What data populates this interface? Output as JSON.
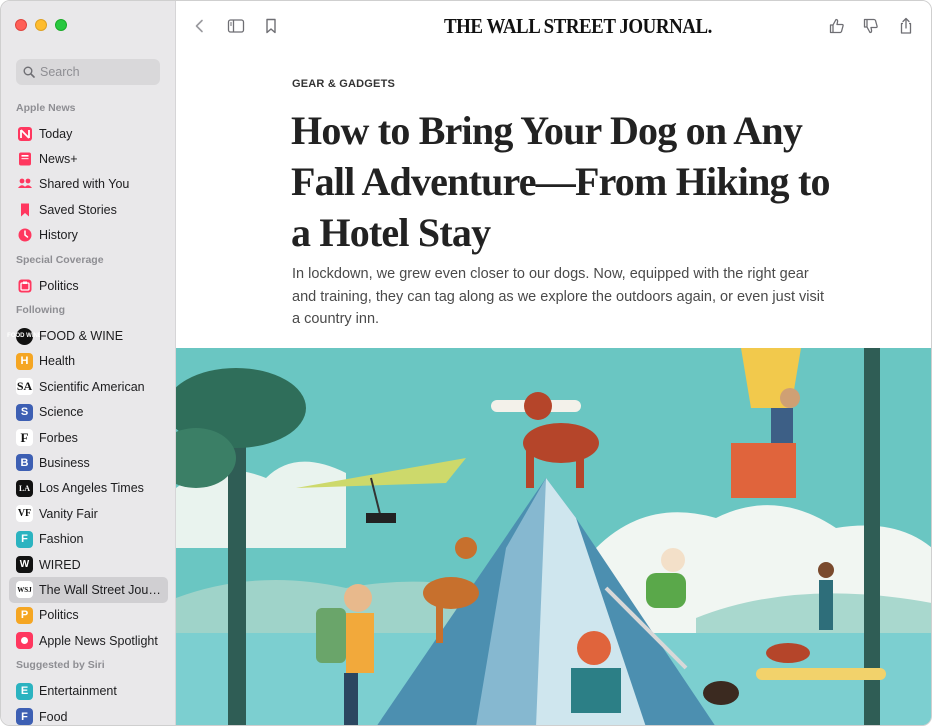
{
  "sidebar": {
    "search_placeholder": "Search",
    "sections": {
      "apple_news": "Apple News",
      "special_coverage": "Special Coverage",
      "following": "Following",
      "suggested": "Suggested by Siri"
    },
    "apple_news_items": [
      {
        "label": "Today",
        "icon": "news-logo-icon"
      },
      {
        "label": "News+",
        "icon": "news-plus-icon"
      },
      {
        "label": "Shared with You",
        "icon": "shared-people-icon"
      },
      {
        "label": "Saved Stories",
        "icon": "bookmark-icon"
      },
      {
        "label": "History",
        "icon": "clock-icon"
      }
    ],
    "special_items": [
      {
        "label": "Politics",
        "icon": "ballot-icon"
      }
    ],
    "following_items": [
      {
        "label": "FOOD & WINE",
        "badge": "FOOD WINE",
        "color": "#111111"
      },
      {
        "label": "Health",
        "badge": "H",
        "color": "#f5a623"
      },
      {
        "label": "Scientific American",
        "badge": "SA",
        "color": "#ffffff"
      },
      {
        "label": "Science",
        "badge": "S",
        "color": "#3d5fb3"
      },
      {
        "label": "Forbes",
        "badge": "F",
        "color": "#ffffff"
      },
      {
        "label": "Business",
        "badge": "B",
        "color": "#3d5fb3"
      },
      {
        "label": "Los Angeles Times",
        "badge": "LA",
        "color": "#111111"
      },
      {
        "label": "Vanity Fair",
        "badge": "VF",
        "color": "#ffffff"
      },
      {
        "label": "Fashion",
        "badge": "F",
        "color": "#2bb3c0"
      },
      {
        "label": "WIRED",
        "badge": "W",
        "color": "#111111"
      },
      {
        "label": "The Wall Street Jour...",
        "badge": "WSJ",
        "color": "#ffffff",
        "active": true
      },
      {
        "label": "Politics",
        "badge": "P",
        "color": "#f5a623"
      },
      {
        "label": "Apple News Spotlight",
        "badge": "",
        "color": "#ff375f"
      }
    ],
    "suggested_items": [
      {
        "label": "Entertainment",
        "badge": "E",
        "color": "#2bb3c0"
      },
      {
        "label": "Food",
        "badge": "F",
        "color": "#3d5fb3"
      }
    ]
  },
  "toolbar": {
    "masthead": "THE WALL STREET JOURNAL."
  },
  "article": {
    "kicker": "GEAR & GADGETS",
    "headline": "How to Bring Your Dog on Any Fall Adventure—From Hiking to a Hotel Stay",
    "dek": "In lockdown, we grew even closer to our dogs. Now, equipped with the right gear and training, they can tag along as we explore the outdoors again, or even just visit a country inn."
  }
}
